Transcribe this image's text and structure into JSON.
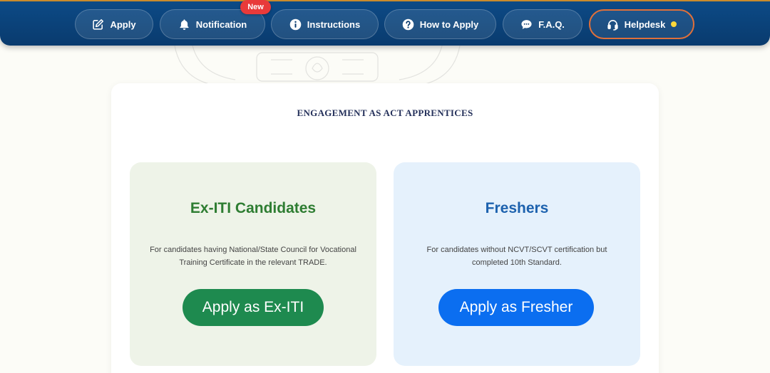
{
  "nav": {
    "apply_label": "Apply",
    "notification_label": "Notification",
    "notification_badge": "New",
    "instructions_label": "Instructions",
    "how_to_apply_label": "How to Apply",
    "faq_label": "F.A.Q.",
    "helpdesk_label": "Helpdesk"
  },
  "main": {
    "title": "ENGAGEMENT AS ACT APPRENTICES",
    "iti": {
      "heading": "Ex-ITI Candidates",
      "description": "For candidates having National/State Council for Vocational Training Certificate in the relevant TRADE.",
      "button_label": "Apply as Ex-ITI"
    },
    "fresher": {
      "heading": "Freshers",
      "description": "For candidates without NCVT/SCVT certification but completed 10th Standard.",
      "button_label": "Apply as Fresher"
    }
  },
  "colors": {
    "nav_bg": "#0a3b6e",
    "helpdesk_border": "#e0703a",
    "iti_accent": "#2e7d32",
    "iti_button": "#1e8a4f",
    "fresher_accent": "#1d62ae",
    "fresher_button": "#0b6ef0",
    "badge": "#e83a3a"
  },
  "icons": {
    "apply": "edit-icon",
    "notification": "bell-icon",
    "instructions": "info-icon",
    "how_to_apply": "question-icon",
    "faq": "chat-icon",
    "helpdesk": "headset-icon"
  }
}
